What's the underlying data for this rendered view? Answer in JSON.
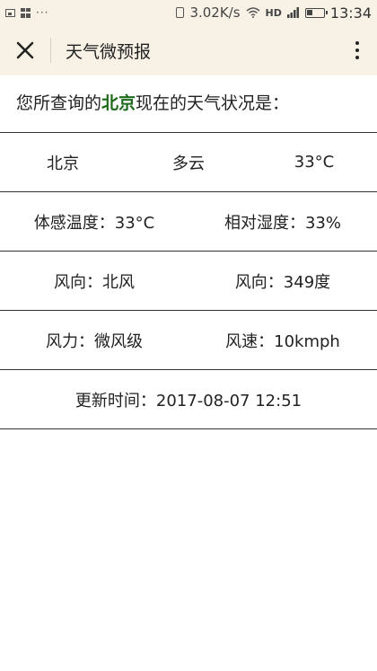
{
  "status_bar": {
    "network_speed": "3.02K/s",
    "hd_label": "HD",
    "time": "13:34"
  },
  "nav": {
    "title": "天气微预报"
  },
  "intro": {
    "prefix": "您所查询的",
    "city": "北京",
    "suffix": "现在的天气状况是："
  },
  "weather": {
    "city": "北京",
    "condition": "多云",
    "temperature": "33°C",
    "feels_like": "体感温度：33°C",
    "humidity": "相对湿度：33%",
    "wind_direction": "风向：北风",
    "wind_degree": "风向：349度",
    "wind_force": "风力：微风级",
    "wind_speed": "风速：10kmph",
    "update_time": "更新时间：2017-08-07 12:51"
  },
  "colors": {
    "header_bg": "#f8f1e6",
    "city_highlight": "#1b6a1b",
    "divider": "#333333"
  }
}
